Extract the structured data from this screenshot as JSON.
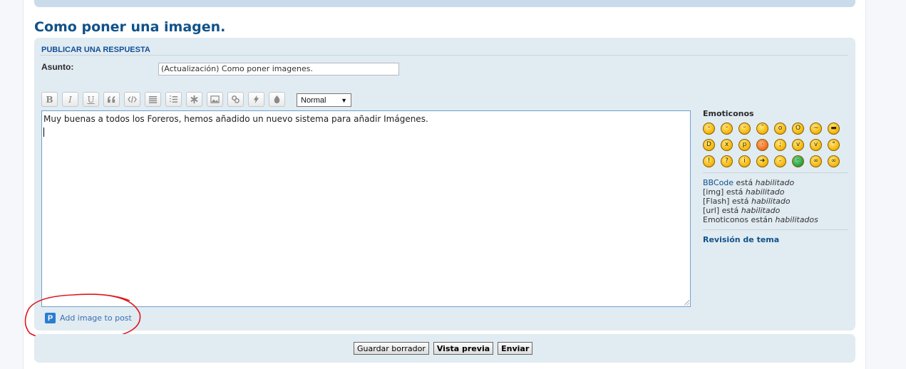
{
  "topic": {
    "title": "Como poner una imagen."
  },
  "reply_panel": {
    "header": "PUBLICAR UNA RESPUESTA",
    "subject_label": "Asunto:",
    "subject_value": "(Actualización) Como poner imagenes.",
    "size_select": "Normal",
    "message_text": "Muy buenas a todos los Foreros, hemos añadido un nuevo sistema para añadir Imágenes.",
    "add_image_label": "Add image to post",
    "add_image_icon_letter": "P",
    "toolbar": [
      {
        "name": "bold-button",
        "glyph": "B"
      },
      {
        "name": "italic-button",
        "glyph": "I"
      },
      {
        "name": "underline-button",
        "glyph": "U"
      },
      {
        "name": "quote-button",
        "glyph": "quote-icon"
      },
      {
        "name": "code-button",
        "glyph": "code-icon"
      },
      {
        "name": "list-button",
        "glyph": "list-icon"
      },
      {
        "name": "ordered-list-button",
        "glyph": "ordered-list-icon"
      },
      {
        "name": "list-item-button",
        "glyph": "asterisk-icon"
      },
      {
        "name": "image-button",
        "glyph": "image-icon"
      },
      {
        "name": "link-button",
        "glyph": "link-icon"
      },
      {
        "name": "flash-button",
        "glyph": "flash-icon"
      },
      {
        "name": "color-button",
        "glyph": "drop-icon"
      }
    ]
  },
  "sidebar": {
    "emoticons_title": "Emoticonos",
    "emoticons": [
      "grin",
      "smile",
      "wink",
      "sad",
      "surprised",
      "shocked",
      "confused",
      "cool",
      "laughing",
      "mad",
      "razz",
      "embarrassed",
      "crying",
      "evil",
      "twisted",
      "rolleyes",
      "exclaim",
      "question",
      "idea",
      "arrow",
      "neutral",
      "mrgreen",
      "geek",
      "ugeek"
    ],
    "bbcode_link": "BBCode",
    "status_lines": [
      {
        "prefix": "",
        "middle": " está ",
        "value": "habilitado"
      },
      {
        "prefix": "[img]",
        "middle": " está ",
        "value": "habilitado"
      },
      {
        "prefix": "[Flash]",
        "middle": " está ",
        "value": "habilitado"
      },
      {
        "prefix": "[url]",
        "middle": " está ",
        "value": "habilitado"
      },
      {
        "prefix": "Emoticonos",
        "middle": " están ",
        "value": "habilitados"
      }
    ],
    "review_label": "Revisión de tema"
  },
  "buttons": {
    "save_draft": "Guardar borrador",
    "preview": "Vista previa",
    "submit": "Enviar"
  },
  "colors": {
    "accent": "#105289",
    "panel_bg": "#e1ebf2",
    "annotation": "#e0161d"
  }
}
